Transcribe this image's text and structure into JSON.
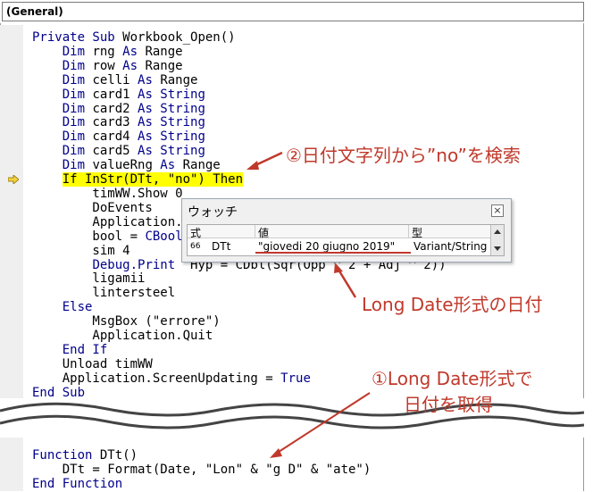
{
  "header": {
    "object_dropdown": "(General)"
  },
  "code_lines_top": [
    [
      {
        "t": "Private Sub ",
        "k": 1
      },
      {
        "t": "Workbook_Open()"
      }
    ],
    [
      {
        "t": "    "
      },
      {
        "t": "Dim ",
        "k": 1
      },
      {
        "t": "rng "
      },
      {
        "t": "As ",
        "k": 1
      },
      {
        "t": "Range"
      }
    ],
    [
      {
        "t": "    "
      },
      {
        "t": "Dim ",
        "k": 1
      },
      {
        "t": "row "
      },
      {
        "t": "As ",
        "k": 1
      },
      {
        "t": "Range"
      }
    ],
    [
      {
        "t": "    "
      },
      {
        "t": "Dim ",
        "k": 1
      },
      {
        "t": "celli "
      },
      {
        "t": "As ",
        "k": 1
      },
      {
        "t": "Range"
      }
    ],
    [
      {
        "t": "    "
      },
      {
        "t": "Dim ",
        "k": 1
      },
      {
        "t": "card1 "
      },
      {
        "t": "As String",
        "k": 1
      }
    ],
    [
      {
        "t": "    "
      },
      {
        "t": "Dim ",
        "k": 1
      },
      {
        "t": "card2 "
      },
      {
        "t": "As String",
        "k": 1
      }
    ],
    [
      {
        "t": "    "
      },
      {
        "t": "Dim ",
        "k": 1
      },
      {
        "t": "card3 "
      },
      {
        "t": "As String",
        "k": 1
      }
    ],
    [
      {
        "t": "    "
      },
      {
        "t": "Dim ",
        "k": 1
      },
      {
        "t": "card4 "
      },
      {
        "t": "As String",
        "k": 1
      }
    ],
    [
      {
        "t": "    "
      },
      {
        "t": "Dim ",
        "k": 1
      },
      {
        "t": "card5 "
      },
      {
        "t": "As String",
        "k": 1
      }
    ],
    [
      {
        "t": "    "
      },
      {
        "t": "Dim ",
        "k": 1
      },
      {
        "t": "valueRng "
      },
      {
        "t": "As ",
        "k": 1
      },
      {
        "t": "Range"
      }
    ],
    [
      {
        "t": "    "
      },
      {
        "t": "If InStr(DTt, \"no\") Then",
        "h": 1
      }
    ],
    [
      {
        "t": "        timWW.Show 0"
      }
    ],
    [
      {
        "t": "        DoEvents"
      }
    ],
    [
      {
        "t": "        Application."
      }
    ],
    [
      {
        "t": "        bool = "
      },
      {
        "t": "CBool",
        "k": 1
      }
    ],
    [
      {
        "t": "        sim 4"
      }
    ],
    [
      {
        "t": "        "
      },
      {
        "t": "Debug.Print",
        "k": 1
      },
      {
        "t": "  Hyp = CDbl(Sqr(Opp ^ 2 + Adj ^ 2))"
      }
    ],
    [
      {
        "t": "        ligamii"
      }
    ],
    [
      {
        "t": "        lintersteel"
      }
    ],
    [
      {
        "t": "    "
      },
      {
        "t": "Else",
        "k": 1
      }
    ],
    [
      {
        "t": "        MsgBox (\"errore\")"
      }
    ],
    [
      {
        "t": "        Application.Quit"
      }
    ],
    [
      {
        "t": "    "
      },
      {
        "t": "End If",
        "k": 1
      }
    ],
    [
      {
        "t": "    Unload timWW"
      }
    ],
    [
      {
        "t": "    Application.ScreenUpdating = "
      },
      {
        "t": "True",
        "k": 1
      }
    ],
    [
      {
        "t": "End Sub",
        "k": 1
      }
    ]
  ],
  "code_lines_bottom": [
    [
      {
        "t": "Function ",
        "k": 1
      },
      {
        "t": "DTt()"
      }
    ],
    [
      {
        "t": "    DTt = Format(Date, \"Lon\" & \"g D\" & \"ate\")"
      }
    ],
    [
      {
        "t": "End Function",
        "k": 1
      }
    ]
  ],
  "watch": {
    "title": "ウォッチ",
    "close": "×",
    "headers": [
      "式",
      "値",
      "型"
    ],
    "row": {
      "icon": "66",
      "expr": "DTt",
      "value": "\"giovedi 20 giugno 2019\"",
      "type": "Variant/String"
    }
  },
  "annotations": {
    "a2": "②日付文字列から”no”を検索",
    "a_long": "Long Date形式の日付",
    "a1_line1": "①Long Date形式で",
    "a1_line2": "日付を取得"
  },
  "colors": {
    "keyword": "#00008b",
    "highlight": "#ffff00",
    "annotation": "#c0392b",
    "pointer": "#f4d03f"
  }
}
